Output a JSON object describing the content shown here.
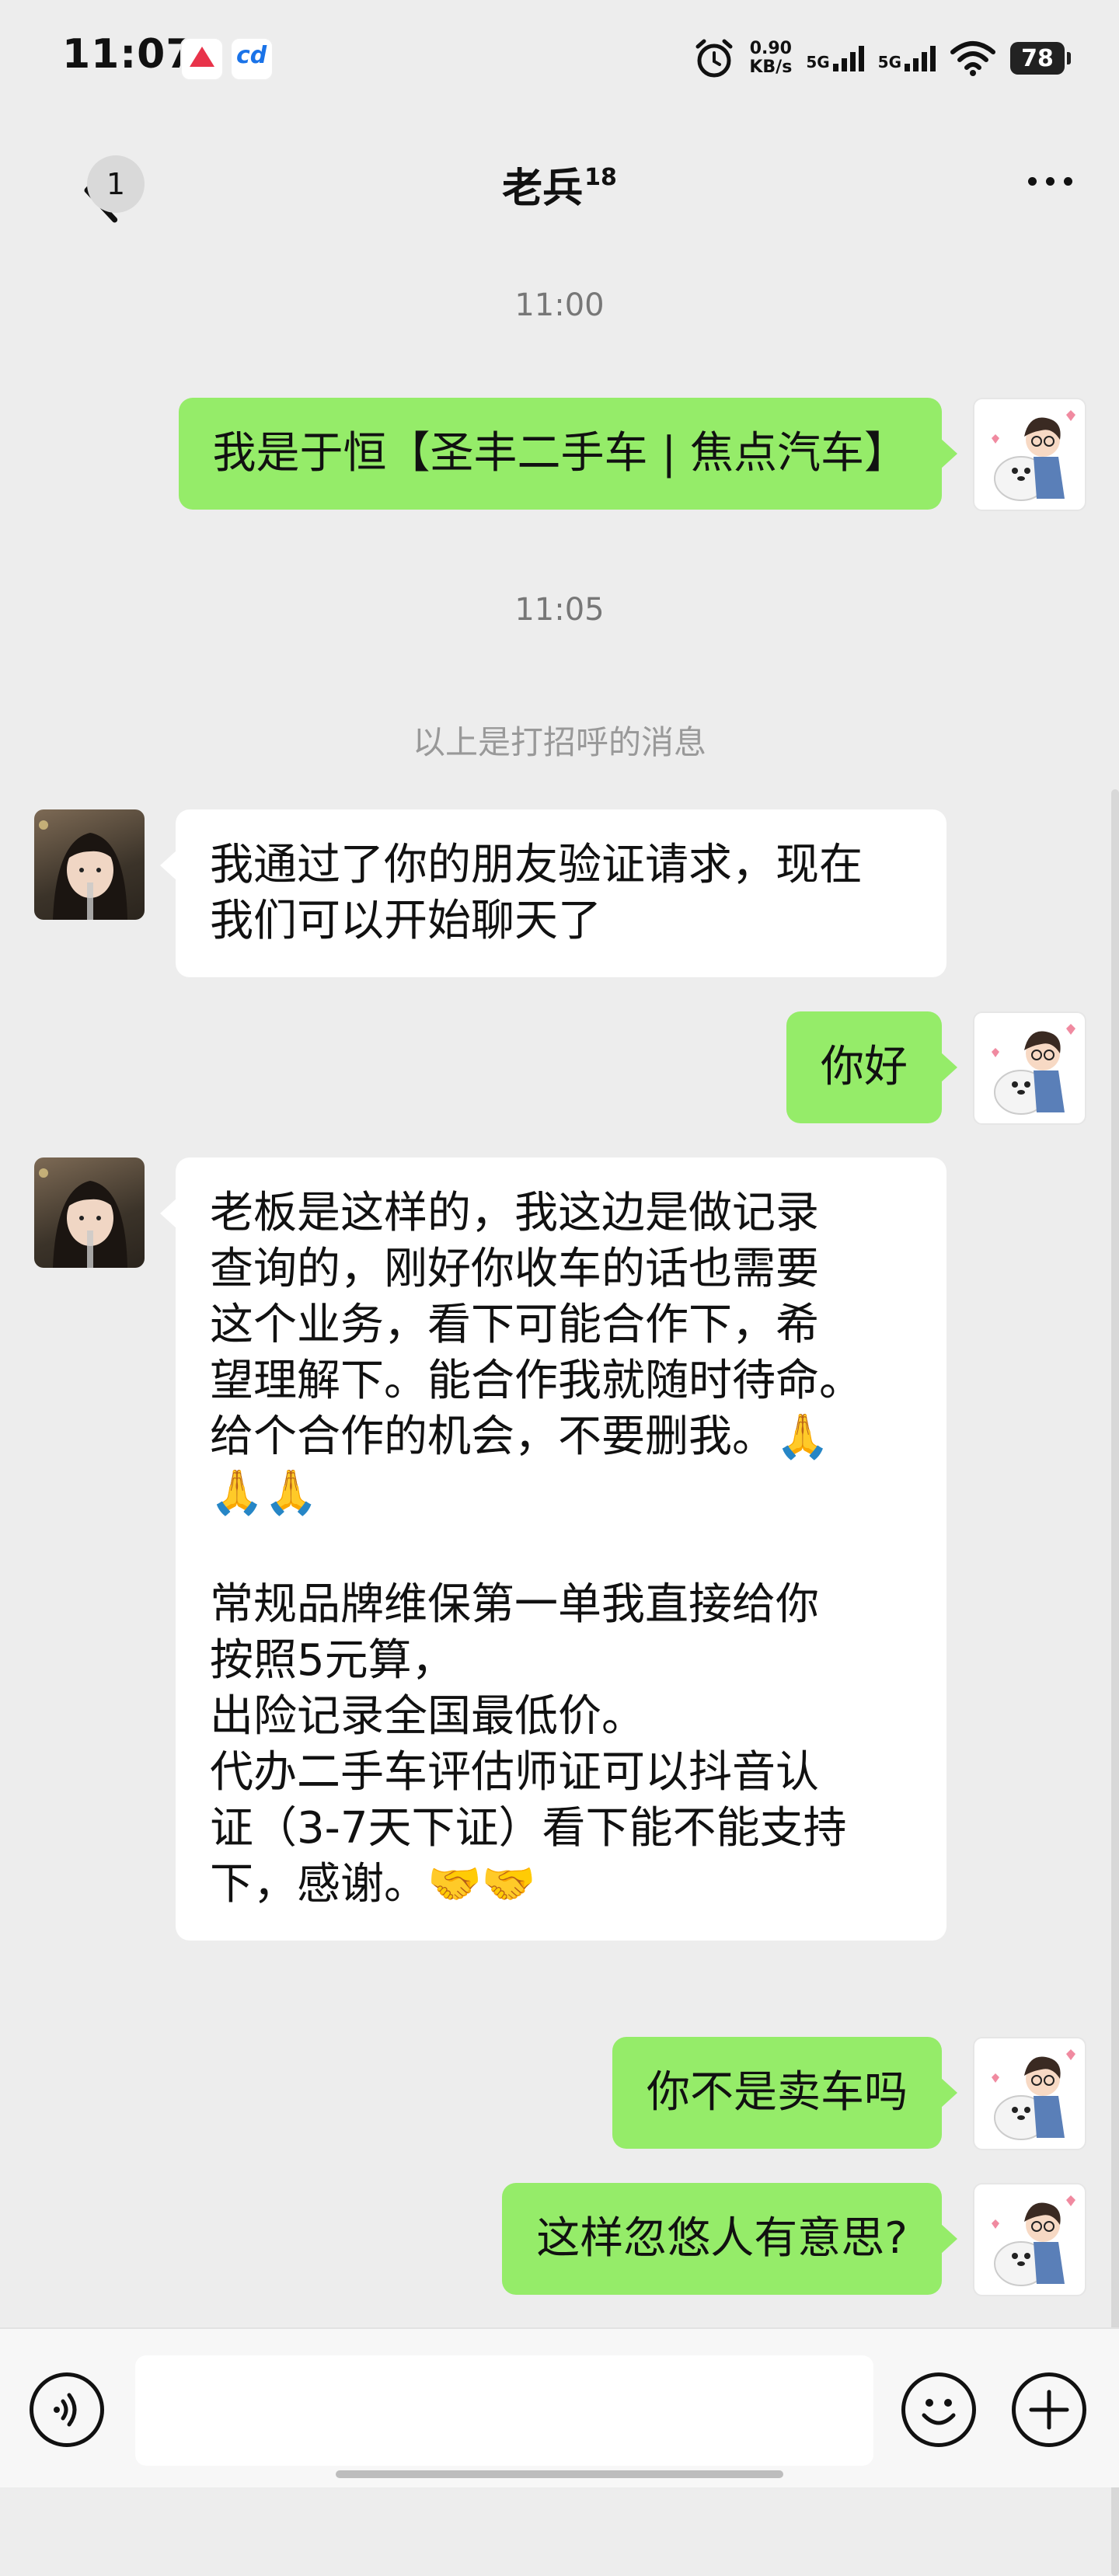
{
  "status_bar": {
    "time": "11:07",
    "speed_value": "0.90",
    "speed_unit": "KB/s",
    "net1": "5G",
    "net2": "5G",
    "battery": "78"
  },
  "header": {
    "back_badge": "1",
    "title": "老兵",
    "title_sup": "18",
    "back_icon": "chevron-left-icon",
    "more_icon": "more-dots-icon"
  },
  "chat": {
    "time_1": "11:00",
    "msg_1": "我是于恒【圣丰二手车 | 焦点汽车】",
    "time_2": "11:05",
    "system_note": "以上是打招呼的消息",
    "msg_2_lines": [
      "我通过了你的朋友验证请求，现在",
      "我们可以开始聊天了"
    ],
    "msg_3": "你好",
    "msg_4_lines": [
      "老板是这样的，我这边是做记录",
      "查询的，刚好你收车的话也需要",
      "这个业务，看下可能合作下，希",
      "望理解下。能合作我就随时待命。",
      "给个合作的机会，不要删我。🙏",
      "🙏🙏",
      "",
      "常规品牌维保第一单我直接给你",
      "按照5元算，",
      "出险记录全国最低价。",
      "代办二手车评估师证可以抖音认",
      "证（3-7天下证）看下能不能支持",
      "下，感谢。🤝🤝"
    ],
    "msg_5": "你不是卖车吗",
    "msg_6": "这样忽悠人有意思?"
  },
  "input_bar": {
    "voice_icon": "voice-icon",
    "emoji_icon": "emoji-icon",
    "plus_icon": "plus-icon"
  },
  "colors": {
    "background": "#ededed",
    "my_bubble": "#95ec69",
    "their_bubble": "#ffffff"
  }
}
